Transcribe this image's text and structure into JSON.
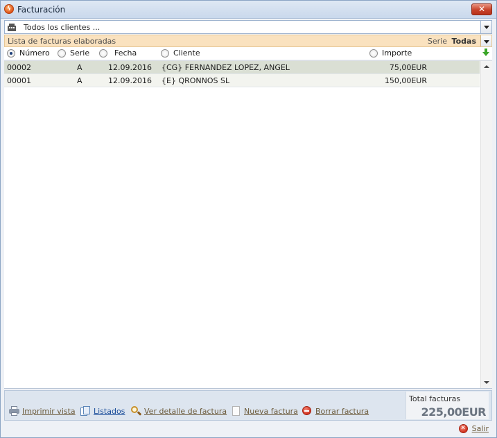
{
  "window": {
    "title": "Facturación"
  },
  "client_selector": {
    "value": "Todos los clientes ..."
  },
  "list_header": {
    "title": "Lista de facturas elaboradas",
    "serie_label": "Serie",
    "serie_value": "Todas"
  },
  "sort_options": [
    {
      "label": "Número",
      "selected": true
    },
    {
      "label": "Serie",
      "selected": false
    },
    {
      "label": "Fecha",
      "selected": false
    },
    {
      "label": "Cliente",
      "selected": false
    },
    {
      "label": "Importe",
      "selected": false
    }
  ],
  "invoices": [
    {
      "numero": "00002",
      "serie": "A",
      "fecha": "12.09.2016",
      "cliente": "{CG} FERNANDEZ LOPEZ, ANGEL",
      "importe": "75,00EUR"
    },
    {
      "numero": "00001",
      "serie": "A",
      "fecha": "12.09.2016",
      "cliente": "{E} QRONNOS SL",
      "importe": "150,00EUR"
    }
  ],
  "toolbar": {
    "print": "Imprimir vista",
    "listings": "Listados",
    "detail": "Ver detalle de factura",
    "new": "Nueva factura",
    "delete": "Borrar factura"
  },
  "totals": {
    "label": "Total facturas",
    "value": "225,00EUR"
  },
  "exit": {
    "label": "Salir"
  },
  "colors": {
    "header_band": "#fae2bf",
    "selected_row": "#dadfd4",
    "toolbar": "#dde5ef"
  }
}
